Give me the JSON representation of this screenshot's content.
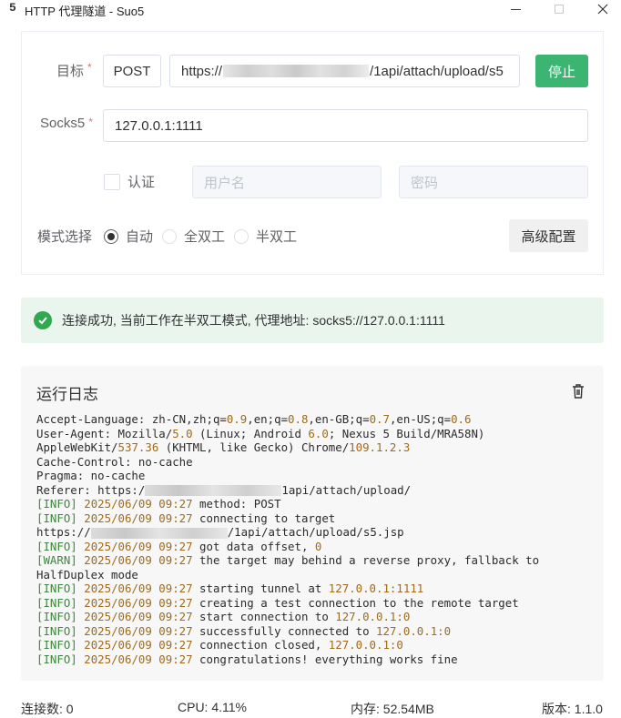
{
  "window": {
    "logo": "5",
    "title": "HTTP 代理隧道 - Suo5",
    "minimize": "–",
    "close": "✕"
  },
  "form": {
    "target_label": "目标",
    "required_mark": "*",
    "method": "POST",
    "url_prefix": "https://",
    "url_suffix": "/1api/attach/upload/s5",
    "stop_label": "停止",
    "socks5_label": "Socks5",
    "socks5_value": "127.0.0.1:1111",
    "auth_label": "认证",
    "auth_checked": false,
    "username_placeholder": "用户名",
    "password_placeholder": "密码",
    "mode_label": "模式选择",
    "modes": [
      {
        "label": "自动",
        "checked": true
      },
      {
        "label": "全双工",
        "checked": false
      },
      {
        "label": "半双工",
        "checked": false
      }
    ],
    "advanced_label": "高级配置"
  },
  "status": {
    "text": "连接成功, 当前工作在半双工模式, 代理地址: socks5://127.0.0.1:1111",
    "color": "#2fa84f"
  },
  "log": {
    "title": "运行日志",
    "lines": [
      "Accept-Language: zh-CN,zh;q=0.9,en;q=0.8,en-GB;q=0.7,en-US;q=0.6",
      "User-Agent: Mozilla/5.0 (Linux; Android 6.0; Nexus 5 Build/MRA58N)",
      "AppleWebKit/537.36 (KHTML, like Gecko) Chrome/109.1.2.3",
      "Cache-Control: no-cache",
      "Pragma: no-cache",
      "Referer: https:/",
      "[INFO] 2025/06/09 09:27 method: POST",
      "[INFO] 2025/06/09 09:27 connecting to target",
      "https://",
      "[INFO] 2025/06/09 09:27 got data offset, 0",
      "[WARN] 2025/06/09 09:27 the target may behind a reverse proxy, fallback to",
      "HalfDuplex mode",
      "[INFO] 2025/06/09 09:27 starting tunnel at 127.0.0.1:1111",
      "[INFO] 2025/06/09 09:27 creating a test connection to the remote target",
      "[INFO] 2025/06/09 09:27 start connection to 127.0.0.1:0",
      "[INFO] 2025/06/09 09:27 successfully connected to 127.0.0.1:0",
      "[INFO] 2025/06/09 09:27 connection closed, 127.0.0.1:0",
      "[INFO] 2025/06/09 09:27 congratulations! everything works fine"
    ],
    "referer_suffix": "1api/attach/upload/",
    "target_url_suffix": "/1api/attach/upload/s5.jsp"
  },
  "footer": {
    "connections": "连接数: 0",
    "cpu": "CPU: 4.11%",
    "memory": "内存: 52.54MB",
    "version": "版本: 1.1.0"
  },
  "colors": {
    "accent": "#3cb572",
    "success_bg": "#e9f5ed",
    "required": "#f56c6c"
  }
}
